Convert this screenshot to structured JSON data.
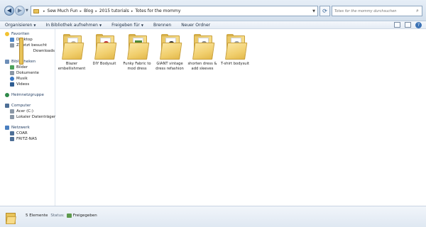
{
  "address": {
    "crumbs": [
      "Sew Much Fun",
      "Blog",
      "2015 tutorials",
      "Totes for the mommy"
    ],
    "search_placeholder": "Totes for the mommy durchsuchen"
  },
  "toolbar": {
    "organize": "Organisieren",
    "include_library": "In Bibliothek aufnehmen",
    "share": "Freigeben für",
    "burn": "Brennen",
    "new_folder": "Neuer Ordner"
  },
  "sidebar": {
    "favorites": {
      "title": "Favoriten",
      "items": [
        "Desktop",
        "Zuletzt besucht",
        "Downloads"
      ]
    },
    "libraries": {
      "title": "Bibliotheken",
      "items": [
        "Bilder",
        "Dokumente",
        "Musik",
        "Videos"
      ]
    },
    "homegroup": "Heimnetzgruppe",
    "computer": {
      "title": "Computer",
      "items": [
        "Acer (C:)",
        "Lokaler Datenträger"
      ]
    },
    "network": {
      "title": "Netzwerk",
      "items": [
        "COAR",
        "FRITZ-NAS"
      ]
    }
  },
  "folders": [
    {
      "name": "Blazer embellishment",
      "thumb": "#b9b2a6"
    },
    {
      "name": "DIY Bodysuit",
      "thumb": "#c0303a"
    },
    {
      "name": "Funky Fabric to mod dress",
      "thumb": "#4f8a3a"
    },
    {
      "name": "GIANT vintage dress refashion",
      "thumb": "#3a3a3a"
    },
    {
      "name": "shorten dress & add sleeves",
      "thumb": "#8a8a8a"
    },
    {
      "name": "T-shirt bodysuit",
      "thumb": "#9aa0a8"
    }
  ],
  "status": {
    "count": "5 Elemente",
    "state_label": "Status:",
    "state_value": "Freigegeben"
  },
  "colors": {
    "folder": "#f1cf6e",
    "toolbar_bg": "#e4ebf4",
    "selection": "#cce4f7"
  }
}
